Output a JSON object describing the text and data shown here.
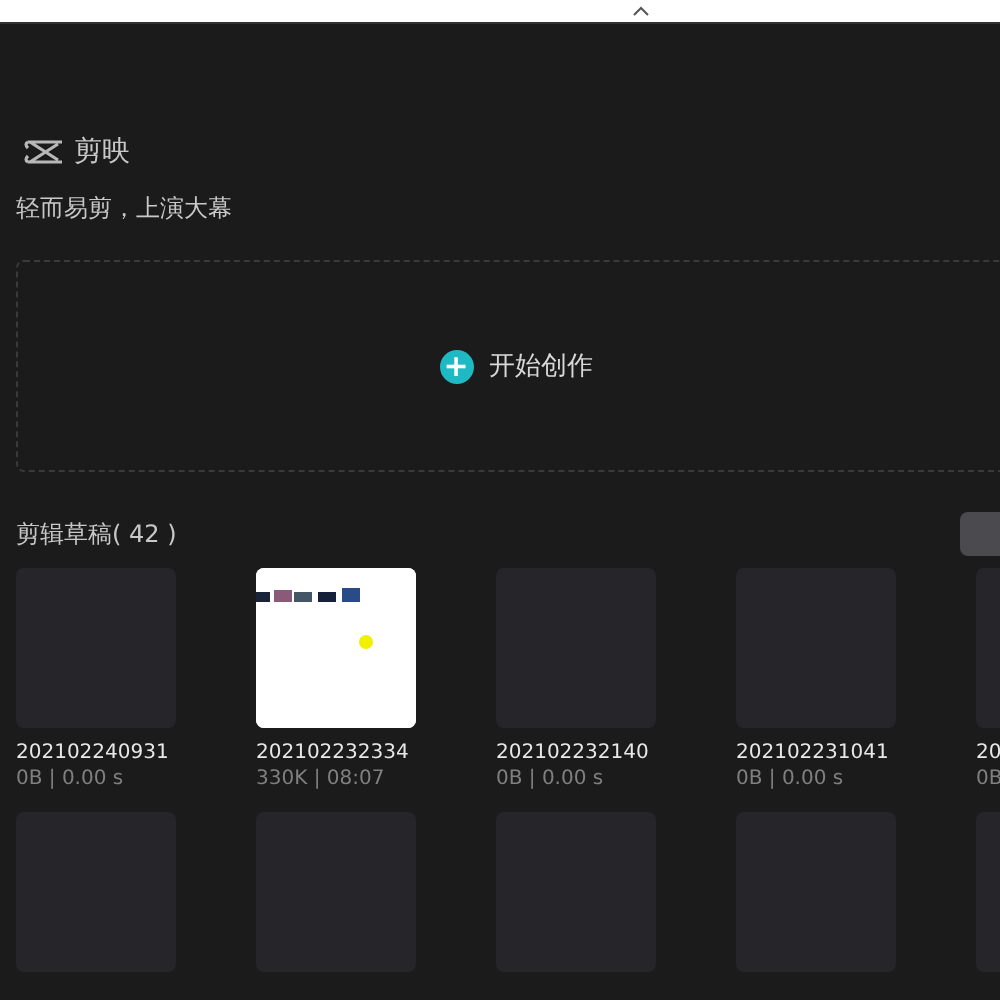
{
  "app": {
    "name": "剪映",
    "tagline": "轻而易剪，上演大幕"
  },
  "create": {
    "label": "开始创作",
    "icon": "+"
  },
  "drafts": {
    "title": "剪辑草稿( 42 )",
    "items": [
      {
        "kind": "empty",
        "name": "202102240931",
        "meta": "0B | 0.00 s"
      },
      {
        "kind": "picture",
        "name": "202102232334",
        "meta": "330K | 08:07"
      },
      {
        "kind": "empty",
        "name": "202102232140",
        "meta": "0B | 0.00 s"
      },
      {
        "kind": "empty",
        "name": "202102231041",
        "meta": "0B | 0.00 s"
      },
      {
        "kind": "empty",
        "name": "20",
        "meta": "0B"
      },
      {
        "kind": "empty"
      },
      {
        "kind": "empty"
      },
      {
        "kind": "empty"
      },
      {
        "kind": "empty"
      },
      {
        "kind": "empty"
      }
    ]
  }
}
